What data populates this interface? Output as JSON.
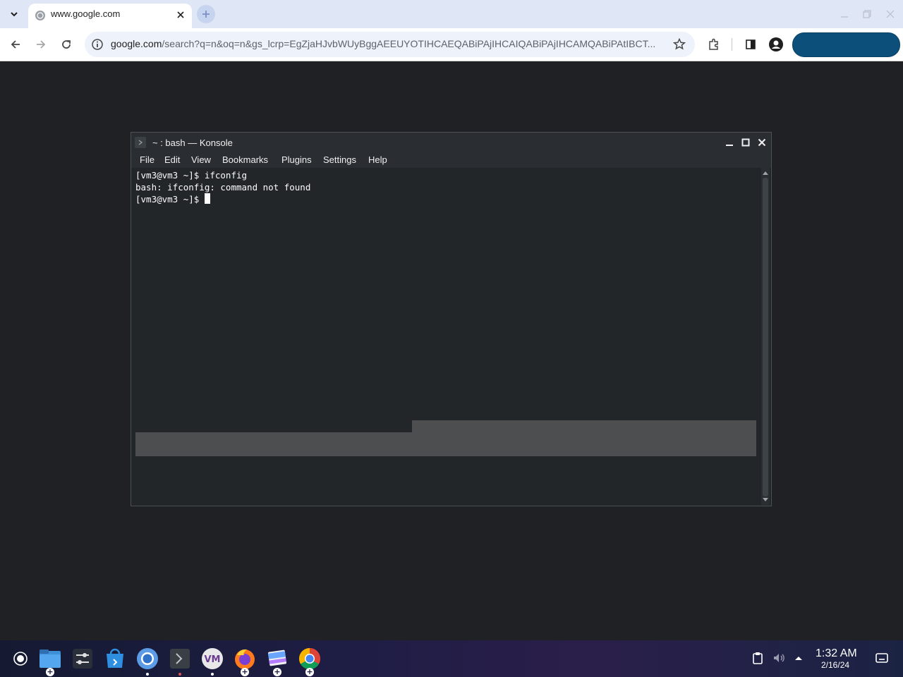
{
  "browser": {
    "tab_title": "www.google.com",
    "url_domain": "google.com",
    "url_path": "/search?q=n&oq=n&gs_lcrp=EgZjaHJvbWUyBggAEEUYOTIHCAEQABiPAjIHCAIQABiPAjIHCAMQABiPAtIBCT...",
    "signin_label": ""
  },
  "konsole": {
    "title": "~ : bash — Konsole",
    "menu": [
      "File",
      "Edit",
      "View",
      "Bookmarks",
      "Plugins",
      "Settings",
      "Help"
    ],
    "lines": [
      "[vm3@vm3 ~]$ ifconfig",
      "bash: ifconfig: command not found",
      "[vm3@vm3 ~]$ "
    ]
  },
  "taskbar": {
    "apps": [
      "files-app",
      "settings-app",
      "store-app",
      "chromium-app",
      "konsole-app",
      "vmware-app",
      "firefox-app",
      "kate-app",
      "chrome-app"
    ],
    "time": "1:32 AM",
    "date": "2/16/24"
  },
  "colors": {
    "desktop": "#202124",
    "tabbar": "#dfe6f5",
    "terminal_bg": "#232629",
    "accent": "#0b4f7a"
  }
}
